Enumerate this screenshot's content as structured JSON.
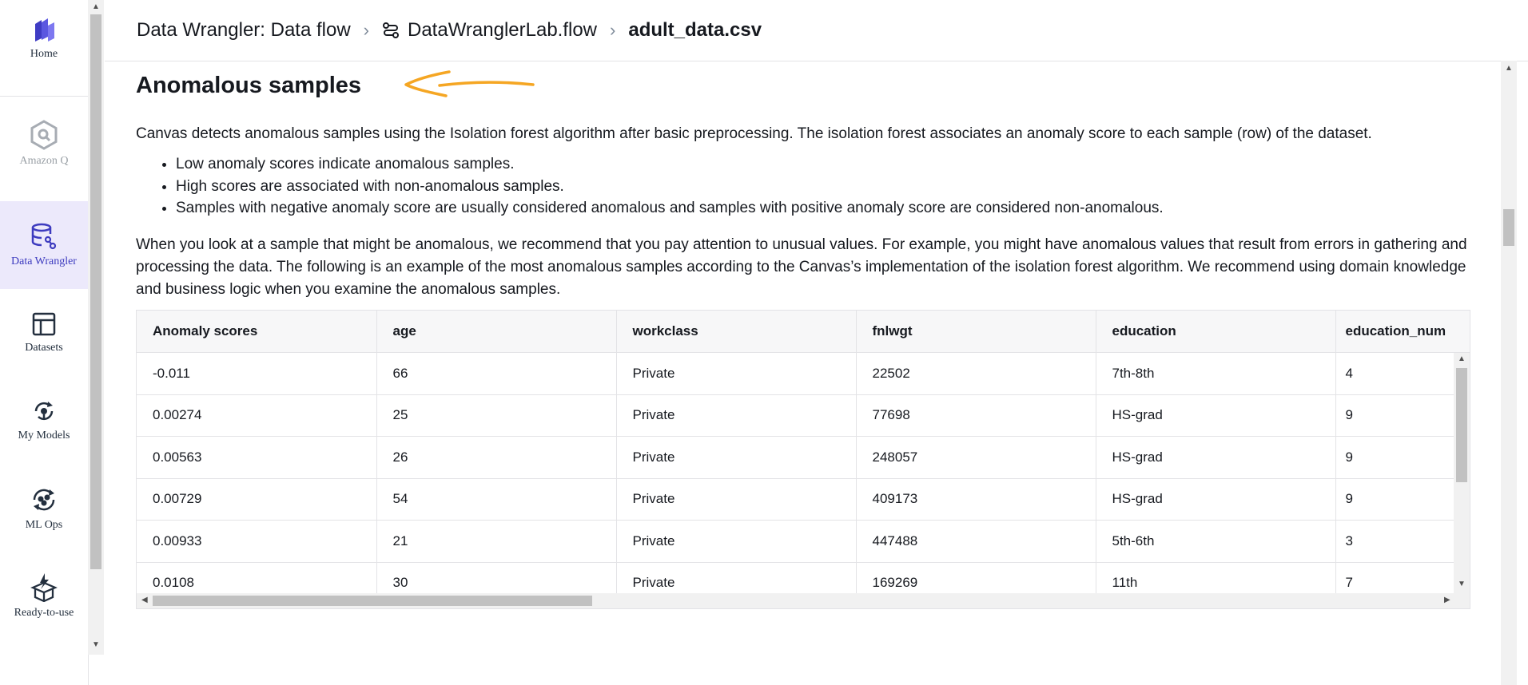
{
  "nav": {
    "items": [
      {
        "label": "Home",
        "icon": "home-icon"
      },
      {
        "label": "Amazon Q",
        "icon": "amazon-q-icon"
      },
      {
        "label": "Data Wrangler",
        "icon": "data-wrangler-icon"
      },
      {
        "label": "Datasets",
        "icon": "datasets-icon"
      },
      {
        "label": "My Models",
        "icon": "my-models-icon"
      },
      {
        "label": "ML Ops",
        "icon": "ml-ops-icon"
      },
      {
        "label": "Ready-to-use",
        "icon": "ready-to-use-icon"
      }
    ]
  },
  "breadcrumb": {
    "root": "Data Wrangler: Data flow",
    "flow": "DataWranglerLab.flow",
    "current": "adult_data.csv"
  },
  "section": {
    "title": "Anomalous samples",
    "intro": "Canvas detects anomalous samples using the Isolation forest algorithm after basic preprocessing. The isolation forest associates an anomaly score to each sample (row) of the dataset.",
    "bullets": [
      "Low anomaly scores indicate anomalous samples.",
      "High scores are associated with non-anomalous samples.",
      "Samples with negative anomaly score are usually considered anomalous and samples with positive anomaly score are considered non-anomalous."
    ],
    "recommendation": "When you look at a sample that might be anomalous, we recommend that you pay attention to unusual values. For example, you might have anomalous values that result from errors in gathering and processing the data. The following is an example of the most anomalous samples according to the Canvas’s implementation of the isolation forest algorithm. We recommend using domain knowledge and business logic when you examine the anomalous samples."
  },
  "table": {
    "columns": [
      "Anomaly scores",
      "age",
      "workclass",
      "fnlwgt",
      "education",
      "education_num"
    ],
    "rows": [
      [
        "-0.011",
        "66",
        "Private",
        "22502",
        "7th-8th",
        "4"
      ],
      [
        "0.00274",
        "25",
        "Private",
        "77698",
        "HS-grad",
        "9"
      ],
      [
        "0.00563",
        "26",
        "Private",
        "248057",
        "HS-grad",
        "9"
      ],
      [
        "0.00729",
        "54",
        "Private",
        "409173",
        "HS-grad",
        "9"
      ],
      [
        "0.00933",
        "21",
        "Private",
        "447488",
        "5th-6th",
        "3"
      ],
      [
        "0.0108",
        "30",
        "Private",
        "169269",
        "11th",
        "7"
      ]
    ]
  },
  "colors": {
    "accent": "#3d3bbf",
    "active_nav_bg": "#ece9fb",
    "annotation": "#f5a623"
  }
}
